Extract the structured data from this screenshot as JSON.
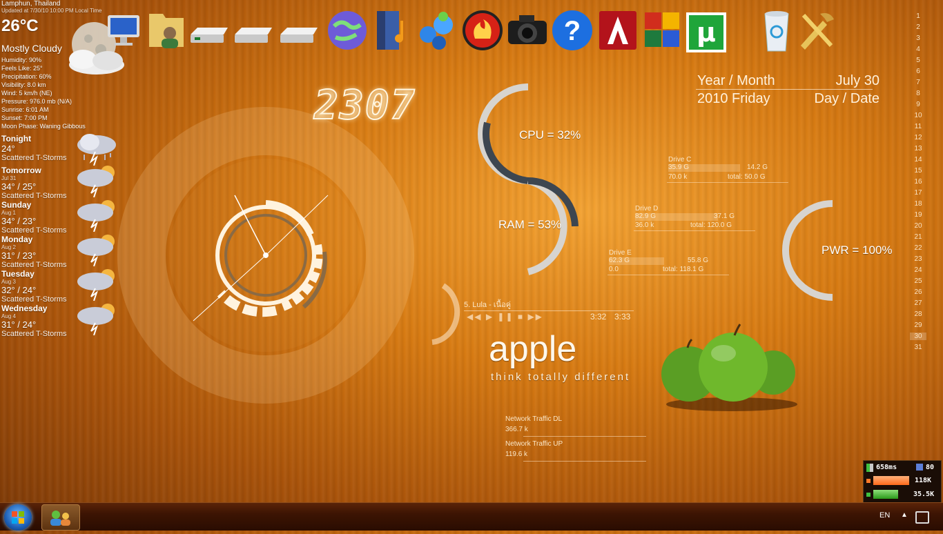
{
  "weather": {
    "location": "Lamphun, Thailand",
    "updated": "Updated at 7/30/10 10:00 PM Local Time",
    "temp": "26°C",
    "condition": "Mostly Cloudy",
    "details": [
      "Humidity: 90%",
      "Feels Like: 25°",
      "Precipitation: 60%",
      "Visibility: 8.0 km",
      "Wind: 5 km/h (NE)",
      "Pressure: 976.0 mb (N/A)",
      "Sunrise: 6:01 AM",
      "Sunset:  7:00 PM",
      "Moon Phase: Waning Gibbous"
    ],
    "forecast": [
      {
        "day": "Tonight",
        "date": "",
        "temp": "24°",
        "cond": "Scattered T-Storms"
      },
      {
        "day": "Tomorrow",
        "date": "Jul 31",
        "temp": "34° / 25°",
        "cond": "Scattered T-Storms"
      },
      {
        "day": "Sunday",
        "date": "Aug 1",
        "temp": "34° / 23°",
        "cond": "Scattered T-Storms"
      },
      {
        "day": "Monday",
        "date": "Aug 2",
        "temp": "31° / 23°",
        "cond": "Scattered T-Storms"
      },
      {
        "day": "Tuesday",
        "date": "Aug 3",
        "temp": "32° / 24°",
        "cond": "Scattered T-Storms"
      },
      {
        "day": "Wednesday",
        "date": "Aug 4",
        "temp": "31° / 24°",
        "cond": "Scattered T-Storms"
      }
    ]
  },
  "desktop_icons": [
    "computer-icon",
    "user-folder-icon",
    "drive-icon",
    "drive-icon",
    "drive-icon",
    "network-globe-icon",
    "music-folder-icon",
    "messenger-icon",
    "burner-icon",
    "camera-icon",
    "help-icon",
    "adobe-icon",
    "office-icon",
    "utorrent-icon",
    "recycle-bin-icon",
    "tools-icon"
  ],
  "clock": {
    "digital": "2307"
  },
  "date_widget": {
    "row1_left": "Year / Month",
    "row1_right": "July 30",
    "row2_left": "2010 Friday",
    "row2_right": "Day / Date"
  },
  "system": {
    "cpu": "CPU = 32%",
    "ram": "RAM = 53%",
    "pwr": "PWR = 100%",
    "cpu_value": 0.32,
    "ram_value": 0.53,
    "pwr_value": 1.0
  },
  "drives": [
    {
      "name": "Drive C",
      "used": "35.9 G",
      "free": "14.2 G",
      "size": "70.0 k",
      "total": "total: 50.0 G"
    },
    {
      "name": "Drive D",
      "used": "82.9 G",
      "free": "37.1 G",
      "size": "36.0 k",
      "total": "total: 120.0 G"
    },
    {
      "name": "Drive E",
      "used": "62.3 G",
      "free": "55.8 G",
      "size": "0.0",
      "total": "total: 118.1 G"
    }
  ],
  "player": {
    "track": "5. Lula - เนื้อคู่",
    "elapsed": "3:32",
    "duration": "3:33"
  },
  "branding": {
    "title": "apple",
    "tagline": "think totally different"
  },
  "network": {
    "dl_label": "Network Traffic DL",
    "dl_value": "366.7 k",
    "ul_label": "Network Traffic UP",
    "ul_value": "119.6 k"
  },
  "calendar": {
    "days": [
      "1",
      "2",
      "3",
      "4",
      "5",
      "6",
      "7",
      "8",
      "9",
      "10",
      "11",
      "12",
      "13",
      "14",
      "15",
      "16",
      "17",
      "18",
      "19",
      "20",
      "21",
      "22",
      "23",
      "24",
      "25",
      "26",
      "27",
      "28",
      "29",
      "30",
      "31"
    ],
    "selected": "30"
  },
  "netmon": {
    "ping": "658ms",
    "count": "80",
    "down": "118K",
    "up": "35.5K"
  },
  "tray": {
    "lang": "EN"
  }
}
